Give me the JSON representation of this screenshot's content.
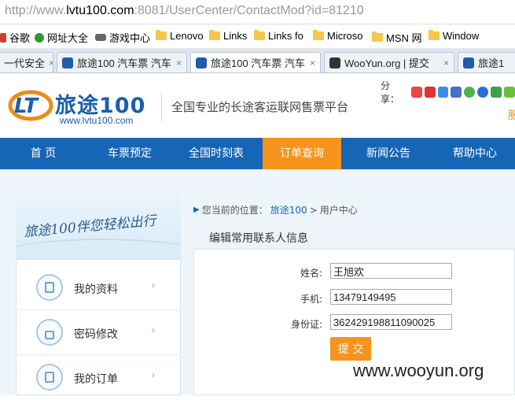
{
  "browser": {
    "url_prefix": "http://www.",
    "url_host": "lvtu100.com",
    "url_rest": ":8081/UserCenter/ContactMod?id=81210",
    "bookmarks": [
      "谷歌",
      "网址大全",
      "游戏中心",
      "Lenovo",
      "Links",
      "Links fo",
      "Microso",
      "MSN 网",
      "Window"
    ],
    "tabs": [
      {
        "label": "一代安全",
        "close": "×"
      },
      {
        "label": "旅途100 汽车票 汽车",
        "close": "×"
      },
      {
        "label": "旅途100 汽车票 汽车",
        "close": "×"
      },
      {
        "label": "WooYun.org | 提交",
        "close": "×"
      },
      {
        "label": "旅途1",
        "close": ""
      }
    ]
  },
  "header": {
    "logo_cn": "旅途100",
    "logo_url": "www.lvtu100.com",
    "slogan": "全国专业的长途客运联网售票平台",
    "share_label": "分享：",
    "corner": "服"
  },
  "nav": {
    "items": [
      "首 页",
      "车票预定",
      "全国时刻表",
      "订单查询",
      "新闻公告",
      "帮助中心"
    ],
    "active_index": 3,
    "active_color": "#f7941d",
    "bar_color": "#1766b5"
  },
  "sidebar": {
    "banner_text": "旅途100伴您轻松出行",
    "items": [
      "我的资料",
      "密码修改",
      "我的订单"
    ],
    "arrow": "›"
  },
  "breadcrumb": {
    "prefix": "您当前的位置：",
    "site": "旅途100",
    "sep": ">",
    "current": "用户中心"
  },
  "form": {
    "title": "编辑常用联系人信息",
    "fields": [
      {
        "label": "姓名:",
        "value": "王旭欢"
      },
      {
        "label": "手机:",
        "value": "13479149495"
      },
      {
        "label": "身份证:",
        "value": "362429198811090025"
      }
    ],
    "submit_label": "提 交"
  },
  "watermark": "www.wooyun.org"
}
